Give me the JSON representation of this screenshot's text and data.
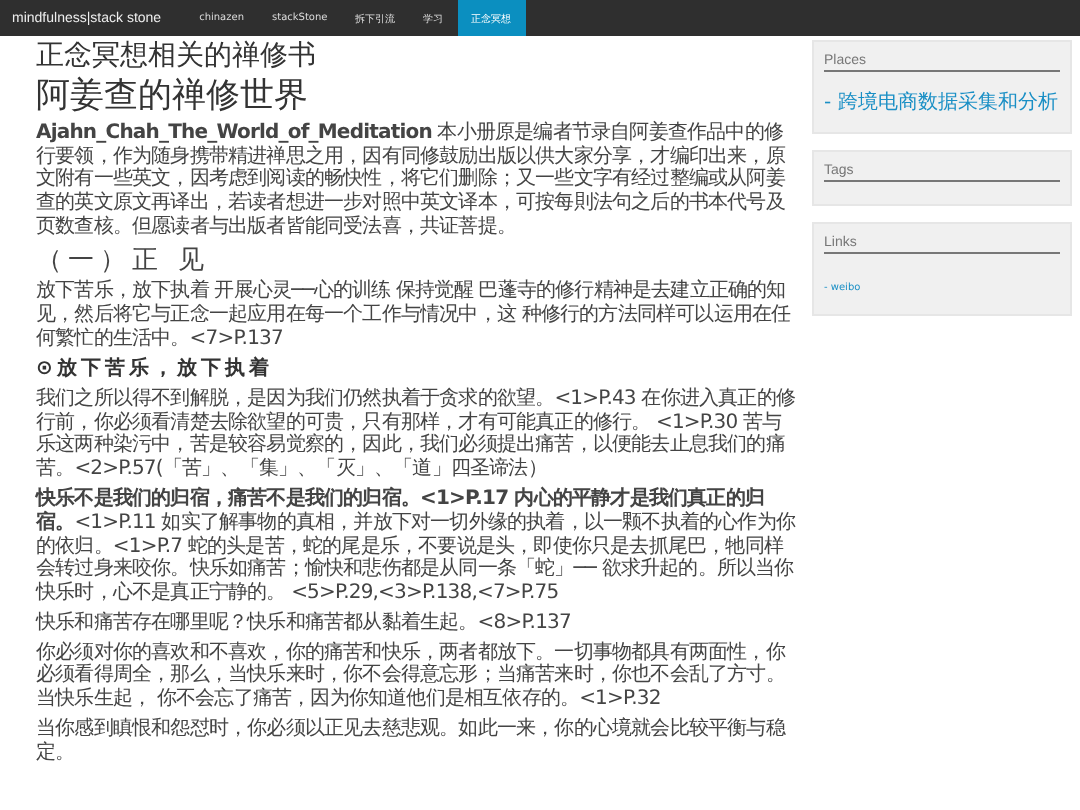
{
  "navbar": {
    "brand": "mindfulness|stack stone",
    "items": [
      {
        "label": "chinazen",
        "selected": false
      },
      {
        "label": "stackStone",
        "selected": false
      },
      {
        "label": "拆下引流",
        "selected": false
      },
      {
        "label": "学习",
        "selected": false
      },
      {
        "label": "正念冥想",
        "selected": true
      }
    ]
  },
  "article": {
    "title": "正念冥想相关的禅修书",
    "subtitle": "阿姜查的禅修世界",
    "blocks": [
      {
        "kind": "text",
        "text": "**Ajahn_Chah_The_World_of_Meditation** 本小册原是编者节录自阿姜查作品中的修行要领，作为随身携带精进禅思之用，因有同修鼓励出版以供大家分享，才编印出来，原文附有一些英文，因考虑到阅读的畅快性，将它们删除；又一些文字有经过整编或从阿姜查的英文原文再译出，若读者想进一步对照中英文译本，可按每則法句之后的书本代号及页数查核。但愿读者与出版者皆能同受法喜，共证菩提。"
      },
      {
        "kind": "heading",
        "text": "（一）正 见"
      },
      {
        "kind": "text",
        "text": "放下苦乐，放下执着 开展心灵──心的训练 保持觉醒 巴蓬寺的修行精神是去建立正确的知见，然后将它与正念一起应用在每一个工作与情况中，这 种修行的方法同样可以运用在任何繁忙的生活中。<7>P.137"
      },
      {
        "kind": "subheading",
        "text": "⊙放下苦乐，放下执着"
      },
      {
        "kind": "text",
        "text": "我们之所以得不到解脱，是因为我们仍然执着于贪求的欲望。<1>P.43 在你进入真正的修行前，你必须看清楚去除欲望的可贵，只有那样，才有可能真正的修行。 <1>P.30 苦与乐这两种染污中，苦是较容易觉察的，因此，我们必须提出痛苦，以便能去止息我们的痛苦。<2>P.57(「苦」、「集」、「灭」、「道」四圣谛法）"
      },
      {
        "kind": "text",
        "text": "**快乐不是我们的归宿，痛苦不是我们的归宿。<1>P.17 内心的平静才是我们真正的归宿。**<1>P.11 如实了解事物的真相，并放下对一切外缘的执着，以一颗不执着的心作为你的依归。<1>P.7 蛇的头是苦，蛇的尾是乐，不要说是头，即使你只是去抓尾巴，牠同样会转过身来咬你。快乐如痛苦；愉快和悲伤都是从同一条「蛇」── 欲求升起的。所以当你快乐时，心不是真正宁静的。 <5>P.29,<3>P.138,<7>P.75"
      },
      {
        "kind": "text",
        "text": "快乐和痛苦存在哪里呢？快乐和痛苦都从黏着生起。<8>P.137"
      },
      {
        "kind": "text",
        "text": "你必须对你的喜欢和不喜欢，你的痛苦和快乐，两者都放下。一切事物都具有两面性，你必须看得周全，那么，当快乐来时，你不会得意忘形；当痛苦来时，你也不会乱了方寸。当快乐生起， 你不会忘了痛苦，因为你知道他们是相互依存的。<1>P.32"
      },
      {
        "kind": "text",
        "text": "当你感到瞋恨和怨怼时，你必须以正见去慈悲观。如此一来，你的心境就会比较平衡与稳定。"
      }
    ]
  },
  "sidebar": [
    {
      "title": "Places",
      "links": [
        "- 跨境电商数据采集和分析"
      ]
    },
    {
      "title": "Tags"
    },
    {
      "title": "Links",
      "links": [
        "- weibo"
      ]
    }
  ]
}
